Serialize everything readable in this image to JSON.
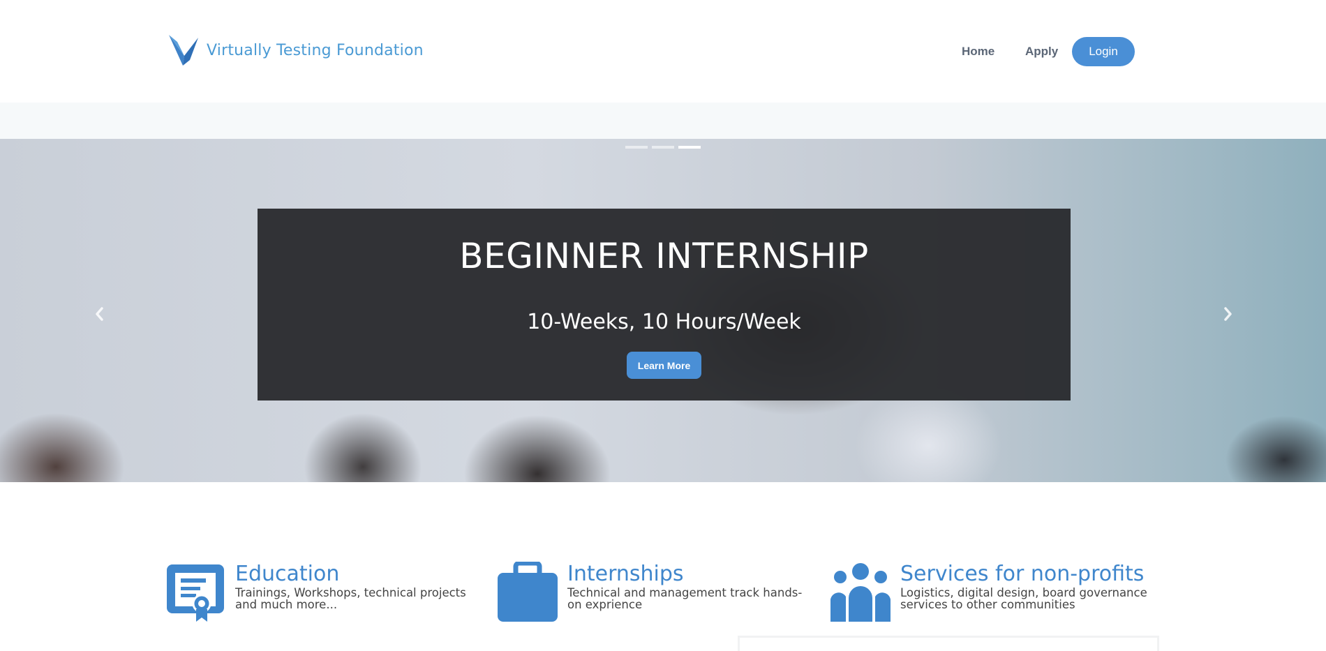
{
  "header": {
    "brand_name": "Virtually Testing Foundation",
    "nav": {
      "home": "Home",
      "apply": "Apply",
      "login": "Login"
    }
  },
  "hero": {
    "slide_count": 3,
    "active_slide": 3,
    "title": "BEGINNER INTERNSHIP",
    "subtitle": "10-Weeks, 10 Hours/Week",
    "cta_label": "Learn More"
  },
  "features": [
    {
      "icon": "certificate-icon",
      "title": "Education",
      "description": "Trainings, Workshops, technical projects and much more..."
    },
    {
      "icon": "briefcase-icon",
      "title": "Internships",
      "description": "Technical and management track hands-on exprience"
    },
    {
      "icon": "group-icon",
      "title": "Services for non-profits",
      "description": "Logistics, digital design, board governance services to other communities"
    }
  ],
  "colors": {
    "brand_blue": "#4a8fd6",
    "brand_text": "#4a9ad4",
    "caption_bg": "#28292c"
  }
}
